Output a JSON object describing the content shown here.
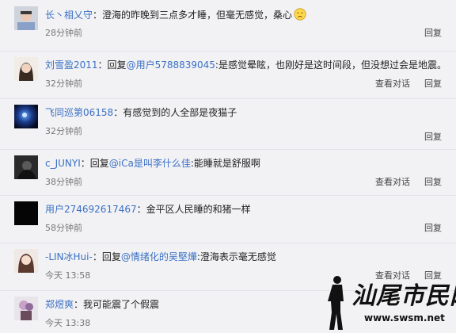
{
  "comments": [
    {
      "user": "长丶相乂守",
      "content": "：澄海的昨晚到三点多才睡，但毫无感觉，桑心",
      "time": "28分钟前",
      "has_emoji": true,
      "actions": [
        "回复"
      ]
    },
    {
      "user": "刘雪盈2011",
      "prefix": "：回复",
      "mention": "@用户5788839045",
      "content": ":是感觉晕眩，也刚好是这时间段，但没想过会是地震。",
      "time": "32分钟前",
      "actions": [
        "查看对话",
        "回复"
      ]
    },
    {
      "user": "飞同巡第06158",
      "content": "：有感觉到的人全部是夜猫子",
      "time": "32分钟前",
      "actions": [
        "回复"
      ]
    },
    {
      "user": "c_JUNYI",
      "prefix": "：回复",
      "mention": "@iCa是叫李什么佳",
      "content": ":能睡就是舒服啊",
      "time": "38分钟前",
      "actions": [
        "查看对话",
        "回复"
      ]
    },
    {
      "user": "用户274692617467",
      "content": "：金平区人民睡的和猪一样",
      "time": "58分钟前",
      "actions": [
        "回复"
      ]
    },
    {
      "user": "-LIN冰Hui-",
      "prefix": "：回复",
      "mention": "@情绪化的吴堅燁",
      "content": ":澄海表示毫无感觉",
      "time": "今天 13:58",
      "actions": [
        "查看对话",
        "回复"
      ]
    },
    {
      "user": "郑煜爽",
      "content": "：我可能震了个假震",
      "time": "今天 13:38",
      "actions": [
        "回复"
      ]
    }
  ],
  "watermark": {
    "text": "汕尾市民网",
    "url": "www.swsm.net"
  }
}
